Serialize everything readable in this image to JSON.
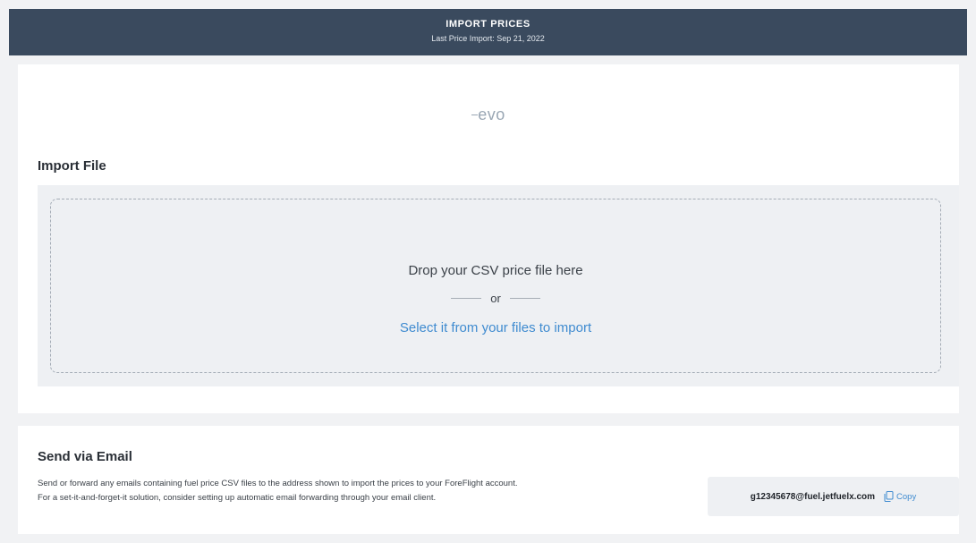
{
  "header": {
    "title": "IMPORT PRICES",
    "subtitle": "Last Price Import: Sep 21, 2022"
  },
  "logo": {
    "text": "evo"
  },
  "import_file": {
    "title": "Import File",
    "drop_text": "Drop your CSV price file here",
    "or_text": "or",
    "select_link": "Select it from your files to import"
  },
  "send_email": {
    "title": "Send via Email",
    "description_line1": "Send or forward any emails containing fuel price CSV files to the address shown to import the prices to your ForeFlight account.",
    "description_line2": "For a set-it-and-forget-it solution, consider setting up automatic email forwarding through your email client.",
    "address": "g12345678@fuel.jetfuelx.com",
    "copy_label": "Copy"
  },
  "colors": {
    "header_bg": "#3a4a5e",
    "link": "#3f8bd0",
    "page_bg": "#f1f2f4"
  },
  "icons": [
    "copy-icon"
  ]
}
